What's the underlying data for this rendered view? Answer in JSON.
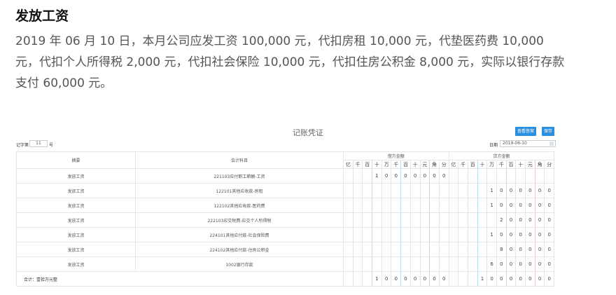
{
  "title": "发放工资",
  "description": "2019 年 06 月 10 日，本月公司应发工资 100,000 元，代扣房租 10,000 元，代垫医药费 10,000 元，代扣个人所得税 2,000 元，代扣社会保险 10,000 元，代扣住房公积金 8,000 元，实际以银行存款支付 60,000 元。",
  "voucher": {
    "title": "记账凭证",
    "view_archive_label": "查看答案",
    "save_label": "保存",
    "word_label": "记字第",
    "number": "11",
    "number_suffix": "号",
    "date_label": "日期",
    "date": "2019-06-10",
    "headers": {
      "summary": "摘要",
      "account": "会计科目",
      "debit": "借方金额",
      "credit": "贷方金额"
    },
    "digit_units": [
      "亿",
      "千",
      "百",
      "十",
      "万",
      "千",
      "百",
      "十",
      "元",
      "角",
      "分"
    ],
    "rows": [
      {
        "summary": "发放工资",
        "account": "221103应付职工薪酬-工资",
        "debit": "10000000",
        "credit": ""
      },
      {
        "summary": "发放工资",
        "account": "122101其他应收款-房租",
        "debit": "",
        "credit": "1000000"
      },
      {
        "summary": "发放工资",
        "account": "122102其他应收款-医药费",
        "debit": "",
        "credit": "1000000"
      },
      {
        "summary": "发放工资",
        "account": "222103应交税费-应交个人所得税",
        "debit": "",
        "credit": "200000"
      },
      {
        "summary": "发放工资",
        "account": "224101其他应付款-社会保险费",
        "debit": "",
        "credit": "1000000"
      },
      {
        "summary": "发放工资",
        "account": "224102其他应付款-住房公积金",
        "debit": "",
        "credit": "800000"
      },
      {
        "summary": "发放工资",
        "account": "1002银行存款",
        "debit": "",
        "credit": "6000000"
      }
    ],
    "total": {
      "label": "合计：壹拾万元整",
      "debit": "10000000",
      "credit": "10000000"
    }
  }
}
